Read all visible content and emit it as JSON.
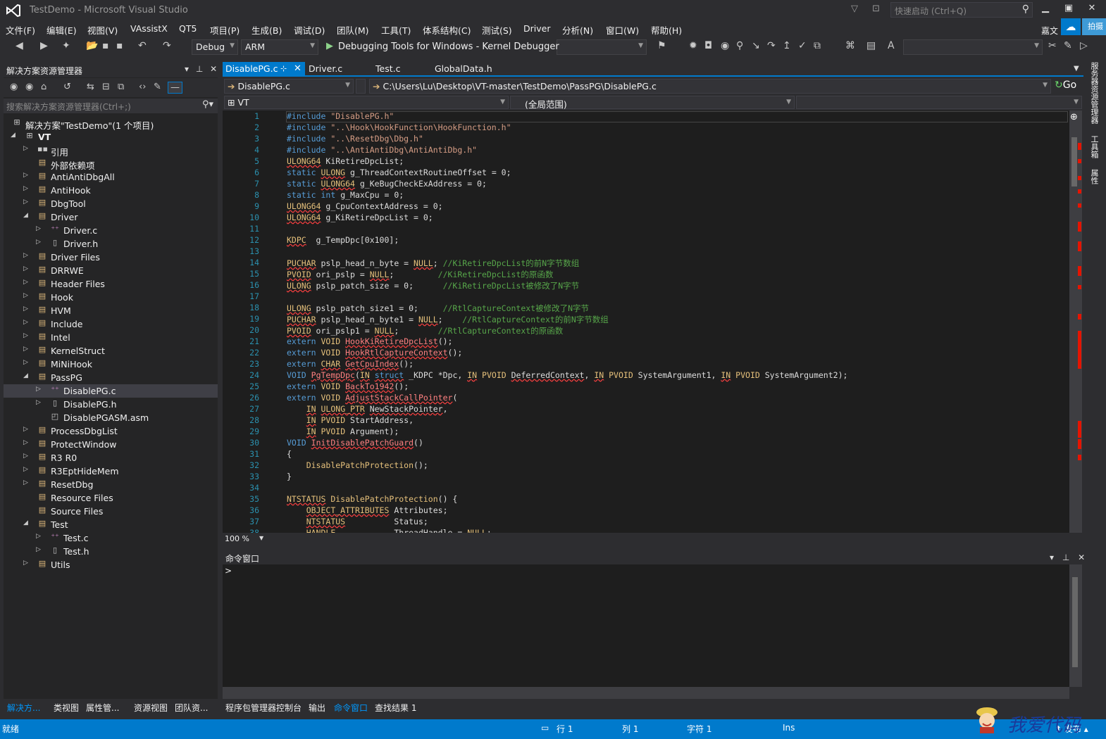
{
  "window": {
    "title": "TestDemo - Microsoft Visual Studio",
    "quick_launch_placeholder": "快速启动 (Ctrl+Q)",
    "user": "嘉文"
  },
  "menu": [
    "文件(F)",
    "编辑(E)",
    "视图(V)",
    "VAssistX",
    "QT5",
    "项目(P)",
    "生成(B)",
    "调试(D)",
    "团队(M)",
    "工具(T)",
    "体系结构(C)",
    "测试(S)",
    "Driver",
    "分析(N)",
    "窗口(W)",
    "帮助(H)"
  ],
  "menu_extra": "拍摄",
  "toolbar": {
    "config": "Debug",
    "platform": "ARM",
    "debugger": "Debugging Tools for Windows - Kernel Debugger"
  },
  "solution_explorer": {
    "title": "解决方案资源管理器",
    "search_placeholder": "搜索解决方案资源管理器(Ctrl+;)",
    "items": [
      {
        "label": "解决方案\"TestDemo\"(1 个项目)",
        "exp": "",
        "icon": "solution"
      },
      {
        "label": "VT",
        "exp": "◢",
        "icon": "project"
      },
      {
        "label": "引用",
        "exp": "▷",
        "icon": "references"
      },
      {
        "label": "外部依赖项",
        "exp": "",
        "icon": "folder"
      },
      {
        "label": "AntiAntiDbgAll",
        "exp": "▷",
        "icon": "folder"
      },
      {
        "label": "AntiHook",
        "exp": "▷",
        "icon": "folder"
      },
      {
        "label": "DbgTool",
        "exp": "▷",
        "icon": "folder"
      },
      {
        "label": "Driver",
        "exp": "◢",
        "icon": "folder"
      },
      {
        "label": "Driver.c",
        "exp": "▷",
        "icon": "cfile"
      },
      {
        "label": "Driver.h",
        "exp": "▷",
        "icon": "hfile"
      },
      {
        "label": "Driver Files",
        "exp": "▷",
        "icon": "folder"
      },
      {
        "label": "DRRWE",
        "exp": "▷",
        "icon": "folder"
      },
      {
        "label": "Header Files",
        "exp": "▷",
        "icon": "folder"
      },
      {
        "label": "Hook",
        "exp": "▷",
        "icon": "folder"
      },
      {
        "label": "HVM",
        "exp": "▷",
        "icon": "folder"
      },
      {
        "label": "Include",
        "exp": "▷",
        "icon": "folder"
      },
      {
        "label": "Intel",
        "exp": "▷",
        "icon": "folder"
      },
      {
        "label": "KernelStruct",
        "exp": "▷",
        "icon": "folder"
      },
      {
        "label": "MiNiHook",
        "exp": "▷",
        "icon": "folder"
      },
      {
        "label": "PassPG",
        "exp": "◢",
        "icon": "folder"
      },
      {
        "label": "DisablePG.c",
        "exp": "▷",
        "icon": "cfile"
      },
      {
        "label": "DisablePG.h",
        "exp": "▷",
        "icon": "hfile"
      },
      {
        "label": "DisablePGASM.asm",
        "exp": "",
        "icon": "asmfile"
      },
      {
        "label": "ProcessDbgList",
        "exp": "▷",
        "icon": "folder"
      },
      {
        "label": "ProtectWindow",
        "exp": "▷",
        "icon": "folder"
      },
      {
        "label": "R3 R0",
        "exp": "▷",
        "icon": "folder"
      },
      {
        "label": "R3EptHideMem",
        "exp": "▷",
        "icon": "folder"
      },
      {
        "label": "ResetDbg",
        "exp": "▷",
        "icon": "folder"
      },
      {
        "label": "Resource Files",
        "exp": "",
        "icon": "folder"
      },
      {
        "label": "Source Files",
        "exp": "",
        "icon": "folder"
      },
      {
        "label": "Test",
        "exp": "◢",
        "icon": "folder"
      },
      {
        "label": "Test.c",
        "exp": "▷",
        "icon": "cfile"
      },
      {
        "label": "Test.h",
        "exp": "▷",
        "icon": "hfile"
      },
      {
        "label": "Utils",
        "exp": "▷",
        "icon": "folder"
      }
    ],
    "selected_index": 20,
    "bottom_tabs": [
      "解决方...",
      "类视图",
      "属性管...",
      "资源视图",
      "团队资..."
    ]
  },
  "editor": {
    "tabs": [
      "DisablePG.c",
      "Driver.c",
      "Test.c",
      "GlobalData.h"
    ],
    "active_tab": 0,
    "file_combo": "DisablePG.c",
    "path": "C:\\Users\\Lu\\Desktop\\VT-master\\TestDemo\\PassPG\\DisablePG.c",
    "go_label": "Go",
    "project_combo": "VT",
    "scope_combo": "(全局范围)",
    "zoom": "100 %"
  },
  "code_lines": [
    "<span class=\"kw\">#include</span> <span class=\"str\">\"DisablePG.h\"</span>",
    "<span class=\"kw\">#include</span> <span class=\"str\">\"..\\Hook\\HookFunction\\HookFunction.h\"</span>",
    "<span class=\"kw\">#include</span> <span class=\"str\">\"..\\ResetDbg\\Dbg.h\"</span>",
    "<span class=\"kw\">#include</span> <span class=\"str\">\"..\\AntiAntiDbg\\AntiAntiDbg.h\"</span>",
    "<span class=\"tyw err\">ULONG64</span> KiRetireDpcList;",
    "<span class=\"kw\">static</span> <span class=\"tyw err\">ULONG</span> g_ThreadContextRoutineOffset = 0;",
    "<span class=\"kw\">static</span> <span class=\"tyw err\">ULONG64</span> g_KeBugCheckExAddress = 0;",
    "<span class=\"kw\">static</span> <span class=\"kw\">int</span> g_MaxCpu = 0;",
    "<span class=\"tyw err\">ULONG64</span> g_CpuContextAddress = 0;",
    "<span class=\"tyw err\">ULONG64</span> g_KiRetireDpcList = 0;",
    "",
    "<span class=\"tyw err\">KDPC</span>  g_TempDpc[0x100];",
    "",
    "<span class=\"tyw err\">PUCHAR</span> pslp_head_n_byte = <span class=\"tyw err\">NULL</span>; <span class=\"cm\">//KiRetireDpcList的前N字节数组</span>",
    "<span class=\"tyw err\">PVOID</span> ori_pslp = <span class=\"tyw err\">NULL</span>;         <span class=\"cm\">//KiRetireDpcList的原函数</span>",
    "<span class=\"tyw err\">ULONG</span> pslp_patch_size = 0;      <span class=\"cm\">//KiRetireDpcList被修改了N字节</span>",
    "",
    "<span class=\"tyw err\">ULONG</span> pslp_patch_size1 = 0;     <span class=\"cm\">//RtlCaptureContext被修改了N字节</span>",
    "<span class=\"tyw err\">PUCHAR</span> pslp_head_n_byte1 = <span class=\"tyw err\">NULL</span>;    <span class=\"cm\">//RtlCaptureContext的前N字节数组</span>",
    "<span class=\"tyw err\">PVOID</span> ori_pslp1 = <span class=\"tyw err\">NULL</span>;        <span class=\"cm\">//RtlCaptureContext的原函数</span>",
    "<span class=\"kw\">extern</span> <span class=\"tyw\">VOID</span> <span class=\"fn\">HookKiRetireDpcList</span>();",
    "<span class=\"kw\">extern</span> <span class=\"tyw\">VOID</span> <span class=\"fn\">HookRtlCaptureContext</span>();",
    "<span class=\"kw\">extern</span> <span class=\"tyw err\">CHAR</span> <span class=\"fn\">GetCpuIndex</span>();",
    "<span class=\"kw\">VOID</span> <span class=\"fn\">PgTempDpc</span>(<span class=\"tyw err\">IN</span> <span class=\"kw err\">struct</span> _KDPC *Dpc, <span class=\"tyw err\">IN</span> <span class=\"tyw\">PVOID</span> <span class=\"err\">DeferredContext</span>, <span class=\"tyw err\">IN</span> <span class=\"tyw\">PVOID</span> SystemArgument1, <span class=\"tyw err\">IN</span> <span class=\"tyw\">PVOID</span> SystemArgument2);",
    "<span class=\"kw\">extern</span> <span class=\"tyw\">VOID</span> <span class=\"fn\">BackTo1942</span>();",
    "<span class=\"kw\">extern</span> <span class=\"tyw\">VOID</span> <span class=\"fn\">AdjustStackCallPointer</span>(",
    "    <span class=\"tyw err\">IN</span> <span class=\"tyw err\">ULONG_PTR</span> <span class=\"err\">NewStackPointer</span>,",
    "    <span class=\"tyw err\">IN</span> <span class=\"tyw\">PVOID</span> StartAddress,",
    "    <span class=\"tyw err\">IN</span> <span class=\"tyw\">PVOID</span> Argument);",
    "<span class=\"kw\">VOID</span> <span class=\"fn\">InitDisablePatchGuard</span>()",
    "{",
    "    <span class=\"tyw\">DisablePatchProtection</span>();",
    "}",
    "",
    "<span class=\"tyw err\">NTSTATUS</span> <span class=\"tyw\">DisablePatchProtection</span>() {",
    "    <span class=\"tyw err\">OBJECT_ATTRIBUTES</span> Attributes;",
    "    <span class=\"tyw err\">NTSTATUS</span>          Status;",
    "    <span class=\"tyw err\">HANDLE</span>            ThreadHandle = <span class=\"tyw err\">NULL</span>;"
  ],
  "command_window": {
    "title": "命令窗口",
    "prompt": ">"
  },
  "bottom_tabs": [
    "程序包管理器控制台",
    "输出",
    "命令窗口",
    "查找结果 1"
  ],
  "bottom_active": 2,
  "right_rail": [
    "服务器资源管理器",
    "工具箱",
    "属性"
  ],
  "status": {
    "ready": "就绪",
    "line": "行 1",
    "col": "列 1",
    "char": "字符 1",
    "mode": "Ins",
    "publish": "发布"
  },
  "watermark": "我爱代码",
  "colors": {
    "accent": "#007acc",
    "background": "#2d2d30",
    "editor_bg": "#1e1e1e",
    "error_mark": "#e51400"
  }
}
